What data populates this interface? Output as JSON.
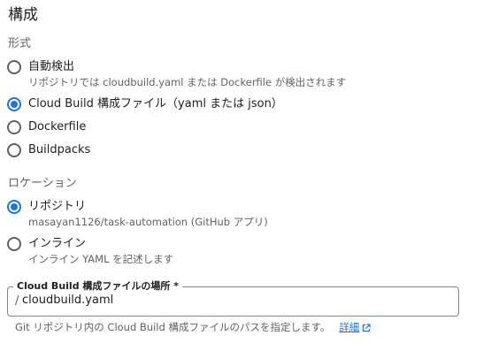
{
  "title": "構成",
  "format": {
    "label": "形式",
    "options": [
      {
        "label": "自動検出",
        "description": "リポジトリでは cloudbuild.yaml または Dockerfile が検出されます",
        "selected": false
      },
      {
        "label": "Cloud Build 構成ファイル（yaml または json）",
        "selected": true
      },
      {
        "label": "Dockerfile",
        "selected": false
      },
      {
        "label": "Buildpacks",
        "selected": false
      }
    ]
  },
  "location": {
    "label": "ロケーション",
    "options": [
      {
        "label": "リポジトリ",
        "description": "masayan1126/task-automation (GitHub アプリ)",
        "selected": true
      },
      {
        "label": "インライン",
        "description": "インライン YAML を記述します",
        "selected": false
      }
    ]
  },
  "config_path": {
    "label": "Cloud Build 構成ファイルの場所 *",
    "prefix": "/",
    "value": "cloudbuild.yaml",
    "hint": "Git リポジトリ内の Cloud Build 構成ファイルのパスを指定します。",
    "link_label": "詳細",
    "link_icon": "external-link-icon"
  },
  "colors": {
    "accent": "#1a73e8",
    "text": "#202124",
    "secondary": "#5f6368"
  }
}
